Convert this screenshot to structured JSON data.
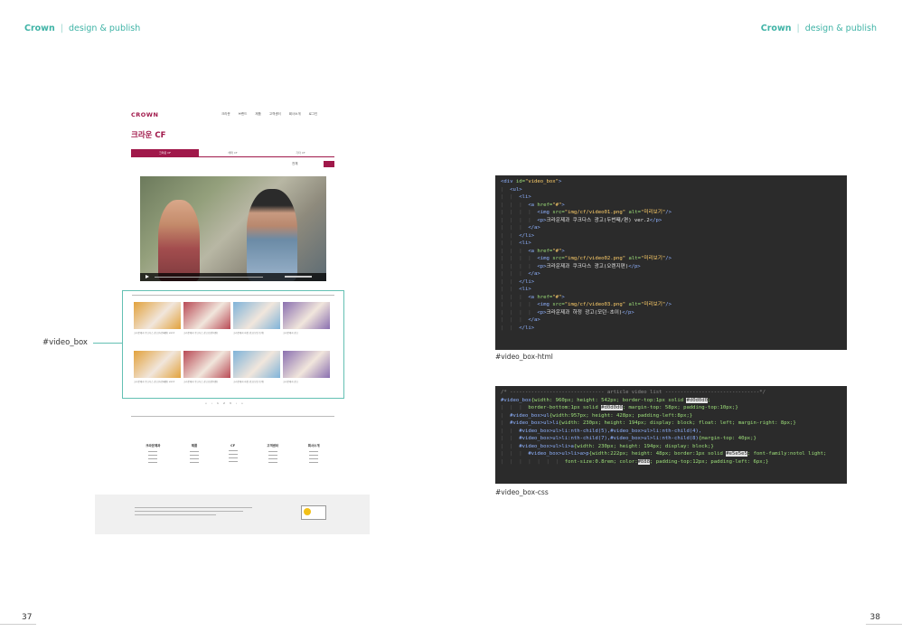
{
  "header": {
    "brand": "Crown",
    "separator": "|",
    "tagline": "design & publish"
  },
  "pages": {
    "left": "37",
    "right": "38"
  },
  "mockup": {
    "logo": "CROWN",
    "nav": [
      "크라운",
      "브랜드",
      "제품",
      "고객센터",
      "회사소개",
      "로그인"
    ],
    "title": "크라운 CF",
    "tabs": [
      "크라운 CF",
      "해태 CF",
      "기타 CF"
    ],
    "select_label": "전체",
    "thumbs": [
      {
        "caption": "크라운제과 쿠크다스 광고(두번째편) ver.2",
        "color": "#e2a23c"
      },
      {
        "caption": "크라운제과 쿠크다스 광고(오렌지편)",
        "color": "#b94a55"
      },
      {
        "caption": "크라운제과 하정 광고(모던·초이)",
        "color": "#7fb3d9"
      },
      {
        "caption": "크라운제과 광고",
        "color": "#8a6fb0"
      },
      {
        "caption": "크라운제과 쿠크다스 광고(두번째편) ver.2",
        "color": "#e2a23c"
      },
      {
        "caption": "크라운제과 쿠크다스 광고(오렌지편)",
        "color": "#b94a55"
      },
      {
        "caption": "크라운제과 하정 광고(모던·초이)",
        "color": "#7fb3d9"
      },
      {
        "caption": "크라운제과 광고",
        "color": "#8a6fb0"
      }
    ],
    "pager": [
      "«",
      "‹",
      "1",
      "2",
      "3",
      "›",
      "»"
    ],
    "footer_menu": [
      "크라운제과",
      "제품",
      "CF",
      "고객센터",
      "회사소개"
    ]
  },
  "annotation_label": "#video_box",
  "html_code": {
    "caption": "#video_box-html",
    "lines": [
      {
        "i": 0,
        "parts": [
          [
            "tag",
            "<div "
          ],
          [
            "att",
            "id="
          ],
          [
            "val",
            "\"video_box\""
          ],
          [
            "tag",
            ">"
          ]
        ]
      },
      {
        "i": 1,
        "parts": [
          [
            "tag",
            "<ul>"
          ]
        ]
      },
      {
        "i": 2,
        "parts": [
          [
            "tag",
            "<li>"
          ]
        ]
      },
      {
        "i": 3,
        "parts": [
          [
            "tag",
            "<a "
          ],
          [
            "att",
            "href="
          ],
          [
            "val",
            "\"#\""
          ],
          [
            "tag",
            ">"
          ]
        ]
      },
      {
        "i": 4,
        "parts": [
          [
            "tag",
            "<img "
          ],
          [
            "att",
            "src="
          ],
          [
            "val",
            "\"img/cf/video01.png\""
          ],
          [
            "att",
            " alt="
          ],
          [
            "val",
            "\"미리보기\""
          ],
          [
            "tag",
            "/>"
          ]
        ]
      },
      {
        "i": 4,
        "parts": [
          [
            "tag",
            "<p>"
          ],
          [
            "txt",
            "크라운제과 쿠크다스 광고(두번째/편) ver.2"
          ],
          [
            "tag",
            "</p>"
          ]
        ]
      },
      {
        "i": 3,
        "parts": [
          [
            "tag",
            "</a>"
          ]
        ]
      },
      {
        "i": 2,
        "parts": [
          [
            "tag",
            "</li>"
          ]
        ]
      },
      {
        "i": 2,
        "parts": [
          [
            "tag",
            "<li>"
          ]
        ]
      },
      {
        "i": 3,
        "parts": [
          [
            "tag",
            "<a "
          ],
          [
            "att",
            "href="
          ],
          [
            "val",
            "\"#\""
          ],
          [
            "tag",
            ">"
          ]
        ]
      },
      {
        "i": 4,
        "parts": [
          [
            "tag",
            "<img "
          ],
          [
            "att",
            "src="
          ],
          [
            "val",
            "\"img/cf/video02.png\""
          ],
          [
            "att",
            " alt="
          ],
          [
            "val",
            "\"미리보기\""
          ],
          [
            "tag",
            "/>"
          ]
        ]
      },
      {
        "i": 4,
        "parts": [
          [
            "tag",
            "<p>"
          ],
          [
            "txt",
            "크라운제과 쿠크다스 광고(오렌지편)"
          ],
          [
            "tag",
            "</p>"
          ]
        ]
      },
      {
        "i": 3,
        "parts": [
          [
            "tag",
            "</a>"
          ]
        ]
      },
      {
        "i": 2,
        "parts": [
          [
            "tag",
            "</li>"
          ]
        ]
      },
      {
        "i": 2,
        "parts": [
          [
            "tag",
            "<li>"
          ]
        ]
      },
      {
        "i": 3,
        "parts": [
          [
            "tag",
            "<a "
          ],
          [
            "att",
            "href="
          ],
          [
            "val",
            "\"#\""
          ],
          [
            "tag",
            ">"
          ]
        ]
      },
      {
        "i": 4,
        "parts": [
          [
            "tag",
            "<img "
          ],
          [
            "att",
            "src="
          ],
          [
            "val",
            "\"img/cf/video03.png\""
          ],
          [
            "att",
            " alt="
          ],
          [
            "val",
            "\"미리보기\""
          ],
          [
            "tag",
            "/>"
          ]
        ]
      },
      {
        "i": 4,
        "parts": [
          [
            "tag",
            "<p>"
          ],
          [
            "txt",
            "크라운제과 하정 광고(모던·초이)"
          ],
          [
            "tag",
            "</p>"
          ]
        ]
      },
      {
        "i": 3,
        "parts": [
          [
            "tag",
            "</a>"
          ]
        ]
      },
      {
        "i": 2,
        "parts": [
          [
            "tag",
            "</li>"
          ]
        ]
      }
    ]
  },
  "css_code": {
    "caption": "#video_box-css",
    "lines": [
      {
        "i": 0,
        "parts": [
          [
            "cmt",
            "/* ------------------------------- article video list -------------------------------*/"
          ]
        ]
      },
      {
        "i": 0,
        "parts": [
          [
            "sel",
            "#video_box"
          ],
          [
            "prop",
            "{width: 960px; height: 542px; border-top:1px solid "
          ],
          [
            "hl",
            "#d0d0d0"
          ],
          [
            "prop",
            ";"
          ]
        ]
      },
      {
        "i": 3,
        "parts": [
          [
            "prop",
            "border-bottom:1px solid "
          ],
          [
            "hl",
            "#d0d0d0"
          ],
          [
            "prop",
            "; margin-top: 58px; padding-top:10px;}"
          ]
        ]
      },
      {
        "i": 1,
        "parts": [
          [
            "sel",
            "#video_box>ul"
          ],
          [
            "prop",
            "{width:957px; height: 428px; padding-left:8px;}"
          ]
        ]
      },
      {
        "i": 1,
        "parts": [
          [
            "sel",
            "#video_box>ul>li"
          ],
          [
            "prop",
            "{width: 230px; height: 194px; display: block; float: left; margin-right: 8px;}"
          ]
        ]
      },
      {
        "i": 2,
        "parts": [
          [
            "sel",
            "#video_box>ul>li:nth-child(5),#video_box>ul>li:nth-child(4),"
          ]
        ]
      },
      {
        "i": 2,
        "parts": [
          [
            "sel",
            "#video_box>ul>li:nth-child(7),#video_box>ul>li:nth-child(8)"
          ],
          [
            "prop",
            "{margin-top: 40px;}"
          ]
        ]
      },
      {
        "i": 2,
        "parts": [
          [
            "sel",
            "#video_box>ul>li>a"
          ],
          [
            "prop",
            "{width: 230px; height: 194px; display: block;}"
          ]
        ]
      },
      {
        "i": 3,
        "parts": [
          [
            "sel",
            "#video_box>ul>li>a>p"
          ],
          [
            "prop",
            "{width:222px; height: 48px; border:1px solid "
          ],
          [
            "hl",
            "#e5e5e5"
          ],
          [
            "prop",
            "; font-family:notol light;"
          ]
        ]
      },
      {
        "i": 7,
        "parts": [
          [
            "prop",
            "font-size:0.8rem; color:"
          ],
          [
            "hl",
            "#888"
          ],
          [
            "prop",
            "; padding-top:12px; padding-left: 6px;}"
          ]
        ]
      }
    ]
  }
}
